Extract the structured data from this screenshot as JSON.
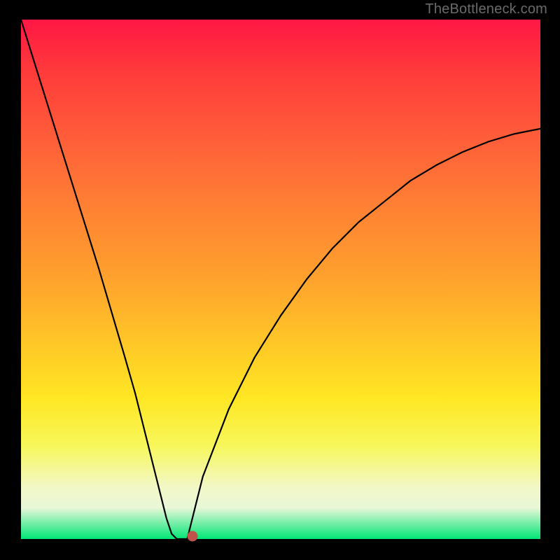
{
  "watermark": "TheBottleneck.com",
  "chart_data": {
    "type": "line",
    "title": "",
    "xlabel": "",
    "ylabel": "",
    "xlim": [
      0,
      100
    ],
    "ylim": [
      0,
      100
    ],
    "grid": false,
    "legend": false,
    "series": [
      {
        "name": "bottleneck-curve",
        "x": [
          0,
          5,
          10,
          15,
          20,
          22,
          24,
          26,
          28,
          29,
          30,
          32,
          33,
          35,
          40,
          45,
          50,
          55,
          60,
          65,
          70,
          75,
          80,
          85,
          90,
          95,
          100
        ],
        "values": [
          100,
          84,
          68,
          52,
          35,
          28,
          20,
          12,
          4,
          1,
          0,
          0,
          4,
          12,
          25,
          35,
          43,
          50,
          56,
          61,
          65,
          69,
          72,
          74.5,
          76.5,
          78,
          79
        ]
      }
    ],
    "marker": {
      "x": 33,
      "y": 0.5
    },
    "background_gradient": {
      "type": "vertical",
      "stops": [
        {
          "pos": 0.0,
          "color": "#ff1744"
        },
        {
          "pos": 0.22,
          "color": "#ff5b3a"
        },
        {
          "pos": 0.5,
          "color": "#ffa22d"
        },
        {
          "pos": 0.73,
          "color": "#ffe724"
        },
        {
          "pos": 0.9,
          "color": "#f2f7c6"
        },
        {
          "pos": 1.0,
          "color": "#00e676"
        }
      ]
    }
  }
}
